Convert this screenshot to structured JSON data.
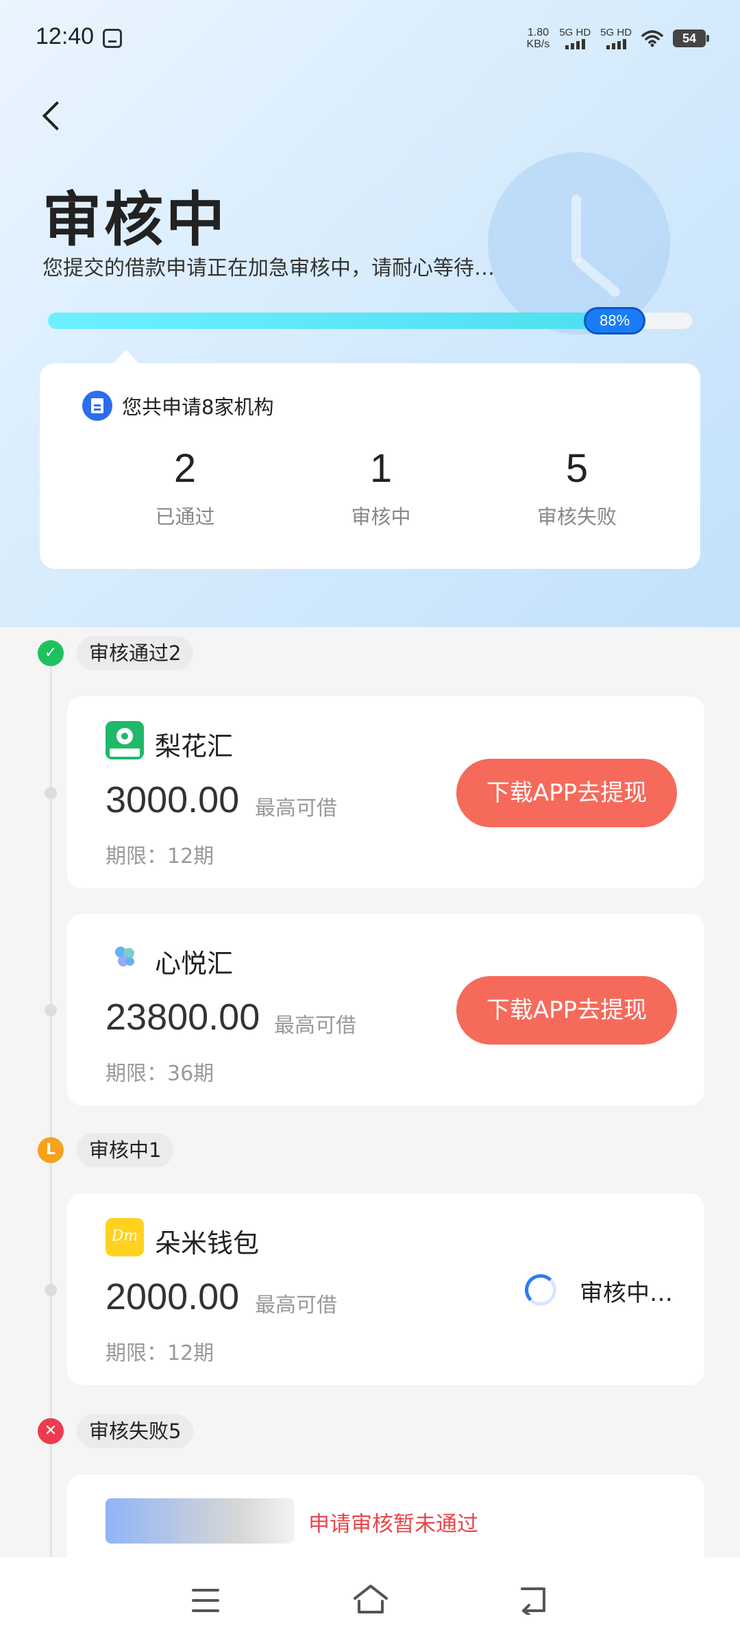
{
  "status_bar": {
    "time": "12:40",
    "net_speed_value": "1.80",
    "net_speed_unit": "KB/s",
    "sim1": "5G HD",
    "sim2": "5G HD",
    "battery": "54"
  },
  "header": {
    "title": "审核中",
    "subtitle": "您提交的借款申请正在加急审核中，请耐心等待…",
    "progress_label": "88%",
    "progress_value": 0.88
  },
  "summary": {
    "title": "您共申请8家机构",
    "stats": [
      {
        "value": "2",
        "label": "已通过"
      },
      {
        "value": "1",
        "label": "审核中"
      },
      {
        "value": "5",
        "label": "审核失败"
      }
    ]
  },
  "sections": {
    "approved": {
      "label": "审核通过2",
      "icon": "check-circle-icon",
      "color": "#1fc15f"
    },
    "reviewing": {
      "label": "审核中1",
      "icon": "clock-circle-icon",
      "color": "#f7a11c"
    },
    "failed": {
      "label": "审核失败5",
      "icon": "close-circle-icon",
      "color": "#ee3c4e"
    }
  },
  "loans": [
    {
      "name": "梨花汇",
      "logo_text": "梨花汇",
      "amount": "3000.00",
      "amount_note": "最高可借",
      "term": "期限：12期",
      "action": "下载APP去提现"
    },
    {
      "name": "心悦汇",
      "amount": "23800.00",
      "amount_note": "最高可借",
      "term": "期限：36期",
      "action": "下载APP去提现"
    },
    {
      "name": "朵米钱包",
      "logo_text": "Dm",
      "amount": "2000.00",
      "amount_note": "最高可借",
      "term": "期限：12期",
      "status": "审核中…"
    }
  ],
  "failed_item": {
    "status": "申请审核暂未通过"
  },
  "colors": {
    "accent_blue": "#1a7cf5",
    "cta_red": "#f56a5b",
    "progress_cyan": "#4ddff0"
  }
}
